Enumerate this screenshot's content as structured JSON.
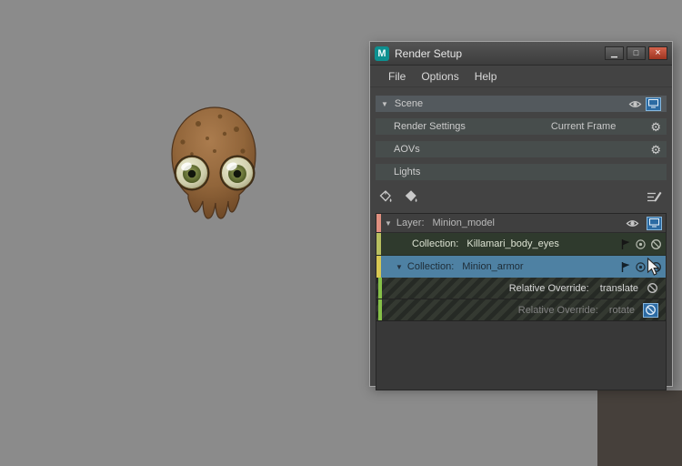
{
  "window": {
    "title": "Render Setup",
    "logo_letter": "M",
    "menu": {
      "items": [
        "File",
        "Options",
        "Help"
      ]
    },
    "scene": {
      "label": "Scene"
    },
    "render_settings": {
      "label": "Render Settings",
      "value": "Current Frame"
    },
    "aovs": {
      "label": "AOVs"
    },
    "lights": {
      "label": "Lights"
    },
    "layer": {
      "prefix": "Layer:",
      "name": "Minion_model"
    },
    "collections": [
      {
        "prefix": "Collection:",
        "name": "Killamari_body_eyes"
      },
      {
        "prefix": "Collection:",
        "name": "Minion_armor"
      }
    ],
    "overrides": [
      {
        "prefix": "Relative Override:",
        "name": "translate"
      },
      {
        "prefix": "Relative Override:",
        "name": "rotate"
      }
    ]
  },
  "icons": {
    "minimize": "▁",
    "maximize": "□",
    "close": "×",
    "gear": "⚙",
    "expand_open": "▼"
  },
  "colors": {
    "viewport_bg": "#8b8b8b",
    "corner_panel": "#46403b",
    "selection_blue": "#4e81a3",
    "layer_stripe": "#e09080",
    "collection_stripe": "#b9bf60",
    "selected_collection_stripe": "#d8c853",
    "override_stripe": "#86c148",
    "close_button": "#b8452f",
    "maya_teal": "#0d9090"
  }
}
